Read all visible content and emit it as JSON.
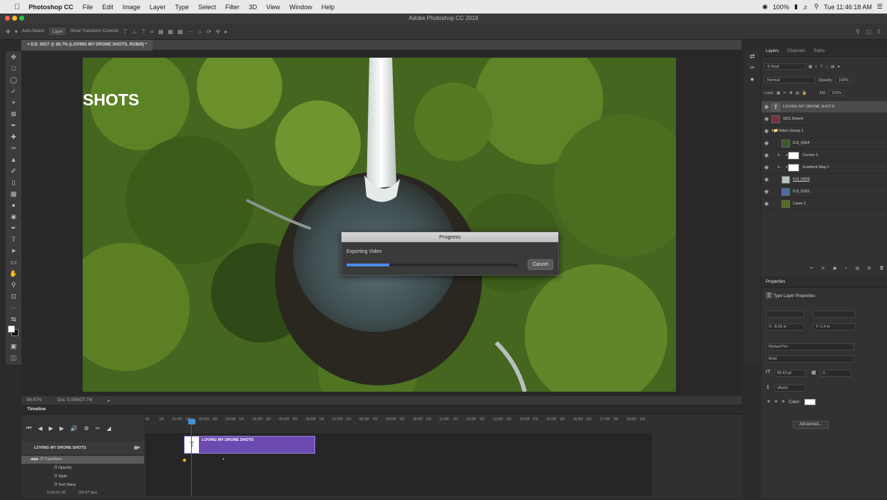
{
  "menubar": {
    "app_name": "Photoshop CC",
    "items": [
      "File",
      "Edit",
      "Image",
      "Layer",
      "Type",
      "Select",
      "Filter",
      "3D",
      "View",
      "Window",
      "Help"
    ],
    "battery": "100%",
    "clock": "Tue 11:46:18 AM"
  },
  "window": {
    "title": "Adobe Photoshop CC 2019"
  },
  "options": {
    "auto_select_label": "Auto-Select:",
    "auto_select_value": "Layer",
    "show_transform_label": "Show Transform Controls"
  },
  "document": {
    "tab_title": "DJI_0027 @ 66.7% (LOVING MY DRONE SHOTS, RGB/8) *",
    "canvas_text": "SHOTS",
    "zoom": "66.67%",
    "doc_info": "Doc: 5.93M/27.7M"
  },
  "dialog": {
    "title": "Progress",
    "message": "Exporting Video",
    "progress": 0.25,
    "cancel_label": "Cancel"
  },
  "layers_panel": {
    "tabs": [
      "Layers",
      "Channels",
      "Paths"
    ],
    "filter_kind": "Kind",
    "blend_mode": "Normal",
    "opacity_label": "Opacity:",
    "opacity_value": "100%",
    "lock_label": "Lock:",
    "fill_label": "Fill:",
    "fill_value": "100%",
    "layers": [
      {
        "name": "LOVING MY DRONE SHOTS",
        "kind": "text",
        "selected": true
      },
      {
        "name": "SDC Bokeh",
        "kind": "video"
      },
      {
        "name": "Video Group 1",
        "kind": "group"
      },
      {
        "name": "DJI_0064",
        "kind": "video"
      },
      {
        "name": "Curves 1",
        "kind": "adjustment"
      },
      {
        "name": "Gradient Map 1",
        "kind": "adjustment"
      },
      {
        "name": "DJI_0839",
        "kind": "video"
      },
      {
        "name": "DJI_0181",
        "kind": "video"
      },
      {
        "name": "Layer 1",
        "kind": "video"
      }
    ]
  },
  "properties_panel": {
    "title": "Properties",
    "subtitle": "Type Layer Properties",
    "x_value": "X: -8.25 in",
    "y_value": "Y: 1.4 in",
    "font_family": "Myriad Pro",
    "font_style": "Bold",
    "font_size": "66.43 pt",
    "tracking": "0",
    "leading": "(Auto)",
    "color_label": "Color:",
    "advanced_label": "Advanced..."
  },
  "timeline": {
    "title": "Timeline",
    "track_name": "LOVING MY DRONE SHOTS",
    "clip_label": "LOVING MY DRONE SHOTS",
    "sub_tracks": [
      "Transform",
      "Opacity",
      "Style",
      "Text Warp"
    ],
    "timecode": "0;00;01;26",
    "fps": "(29.97 fps)",
    "ruler": [
      "00",
      "15f",
      "01:00f",
      "15f",
      "02:00f",
      "15f",
      "03:00f",
      "15f",
      "04:00f",
      "15f",
      "05:00f",
      "15f",
      "06:00f",
      "15f",
      "07:00f",
      "15f",
      "08:00f",
      "15f",
      "09:00f",
      "15f",
      "10:00f",
      "15f",
      "11:00f",
      "15f",
      "12:00f",
      "15f",
      "13:00f",
      "15f",
      "14:00f",
      "15f",
      "15:00f",
      "15f",
      "16:00f",
      "15f",
      "17:00f",
      "15f",
      "18:00f",
      "15f"
    ]
  }
}
